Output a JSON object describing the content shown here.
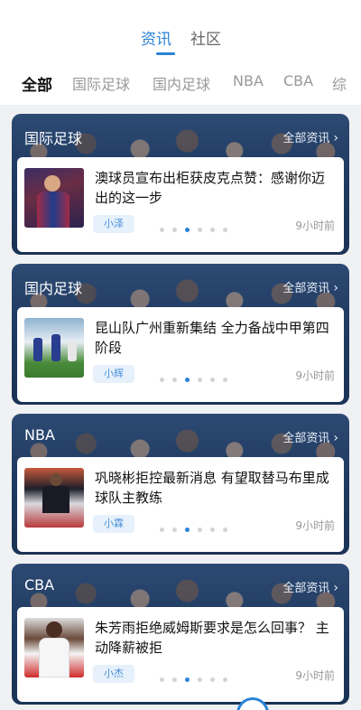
{
  "top_tabs": [
    {
      "label": "资讯",
      "active": true
    },
    {
      "label": "社区",
      "active": false
    }
  ],
  "categories": [
    {
      "label": "全部",
      "active": true
    },
    {
      "label": "国际足球",
      "active": false
    },
    {
      "label": "国内足球",
      "active": false
    },
    {
      "label": "NBA",
      "active": false
    },
    {
      "label": "CBA",
      "active": false
    },
    {
      "label": "综",
      "active": false
    }
  ],
  "sections": [
    {
      "title": "国际足球",
      "all_label": "全部资讯",
      "article": {
        "headline": "澳球员宣布出柜获皮克点赞：感谢你迈出的这一步",
        "author": "小泽",
        "time": "9小时前"
      },
      "carousel_active": 2
    },
    {
      "title": "国内足球",
      "all_label": "全部资讯",
      "article": {
        "headline": "昆山队广州重新集结 全力备战中甲第四阶段",
        "author": "小辉",
        "time": "9小时前"
      },
      "carousel_active": 2
    },
    {
      "title": "NBA",
      "all_label": "全部资讯",
      "article": {
        "headline": "巩晓彬拒控最新消息 有望取替马布里成球队主教练",
        "author": "小霖",
        "time": "9小时前"
      },
      "carousel_active": 2
    },
    {
      "title": "CBA",
      "all_label": "全部资讯",
      "article": {
        "headline": "朱芳雨拒绝威姆斯要求是怎么回事？ 主动降薪被拒",
        "author": "小杰",
        "time": "9小时前"
      },
      "carousel_active": 2
    }
  ],
  "icons": {
    "chevron": "chevron-right-icon"
  },
  "colors": {
    "accent": "#2a83d6",
    "section_bg": "#1f3a5f",
    "author_tag_bg": "#e6f1fb"
  }
}
